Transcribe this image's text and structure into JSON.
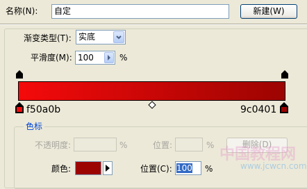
{
  "name_row": {
    "label": "名称(N):",
    "value": "自定",
    "new_button": "新建(W)"
  },
  "gradient_type": {
    "label": "渐变类型(T):",
    "value": "实底"
  },
  "smoothness": {
    "label": "平滑度(M):",
    "value": "100",
    "unit": "%"
  },
  "gradient": {
    "start_color": "#f50a0b",
    "end_color": "#9c0401",
    "left_stop_label": "f50a0b",
    "right_stop_label": "9c0401"
  },
  "color_stops": {
    "group_title": "色标",
    "opacity_label": "不透明度:",
    "opacity_value": "",
    "opacity_unit": "%",
    "opacity_location_label": "位置:",
    "opacity_location_value": "",
    "opacity_location_unit": "%",
    "delete_button": "删除(D)",
    "color_label": "颜色:",
    "color_swatch": "#9c0401",
    "location_label": "位置(C):",
    "location_value": "100",
    "location_unit": "%"
  },
  "watermark": {
    "text": "中国教程网",
    "url": "www.jcwcn.com"
  }
}
